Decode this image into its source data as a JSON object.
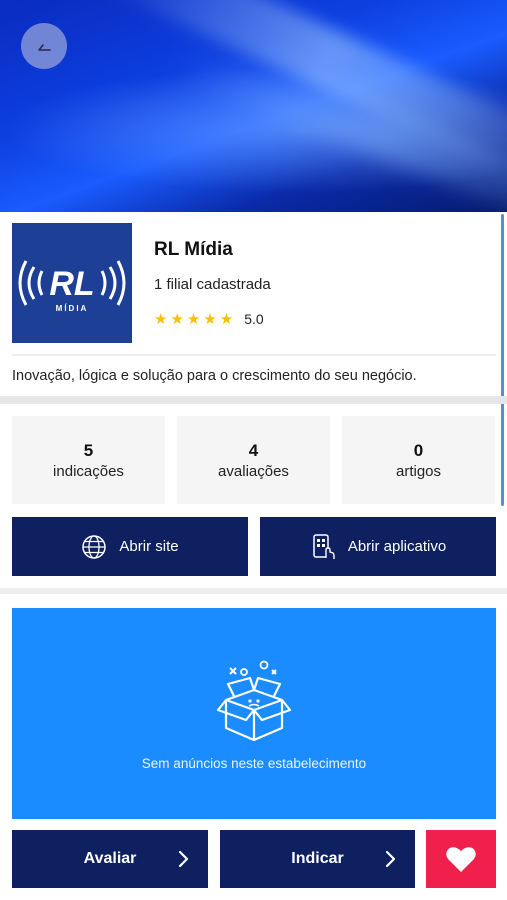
{
  "company": {
    "name": "RL Mídia",
    "branches": "1 filial cadastrada",
    "stars": "★★★★★",
    "rating": "5.0",
    "description": "Inovação, lógica e solução para o crescimento do seu negócio.",
    "logo_text": "RL",
    "logo_subtext": "MÍDIA"
  },
  "stats": [
    {
      "value": "5",
      "label": "indicações"
    },
    {
      "value": "4",
      "label": "avaliações"
    },
    {
      "value": "0",
      "label": "artigos"
    }
  ],
  "actions": {
    "open_site": "Abrir site",
    "open_app": "Abrir aplicativo"
  },
  "ads": {
    "empty_message": "Sem anúncios neste estabelecimento"
  },
  "bottom": {
    "rate": "Avaliar",
    "recommend": "Indicar"
  },
  "icons": {
    "back": "arrow-left-icon",
    "globe": "globe-icon",
    "app": "mobile-app-icon",
    "empty_box": "empty-box-icon",
    "chevron": "chevron-right-icon",
    "heart": "heart-icon"
  },
  "colors": {
    "navy": "#0e2060",
    "ad_blue": "#1a8cff",
    "star": "#f7c000",
    "favorite": "#f01f4b"
  }
}
